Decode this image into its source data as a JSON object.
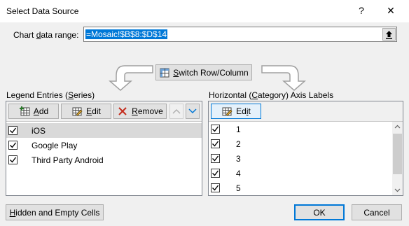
{
  "window": {
    "title": "Select Data Source",
    "help_glyph": "?",
    "close_glyph": "✕"
  },
  "range": {
    "label_pre": "Chart ",
    "label_ul": "d",
    "label_post": "ata range:",
    "value": "=Mosaic!$B$8:$D$14"
  },
  "switch": {
    "label_ul": "S",
    "label_post": "witch Row/Column"
  },
  "legend": {
    "heading_pre": "Legend Entries (",
    "heading_ul": "S",
    "heading_post": "eries)",
    "add_ul": "A",
    "add_post": "dd",
    "edit_ul": "E",
    "edit_post": "dit",
    "remove_ul": "R",
    "remove_post": "emove",
    "items": [
      {
        "label": "iOS",
        "checked": true,
        "selected": true
      },
      {
        "label": "Google Play",
        "checked": true,
        "selected": false
      },
      {
        "label": "Third Party Android",
        "checked": true,
        "selected": false
      }
    ]
  },
  "axis": {
    "heading_pre": "Horizontal (",
    "heading_ul": "C",
    "heading_post": "ategory) Axis Labels",
    "edit_pre": "Ed",
    "edit_ul": "i",
    "edit_post": "t",
    "items": [
      {
        "label": "1",
        "checked": true
      },
      {
        "label": "2",
        "checked": true
      },
      {
        "label": "3",
        "checked": true
      },
      {
        "label": "4",
        "checked": true
      },
      {
        "label": "5",
        "checked": true
      }
    ]
  },
  "footer": {
    "hidden_ul": "H",
    "hidden_post": "idden and Empty Cells",
    "ok": "OK",
    "cancel": "Cancel"
  },
  "colors": {
    "accent": "#0078d7",
    "selected_row": "#d9d9d9",
    "remove_red": "#c42b1c"
  }
}
